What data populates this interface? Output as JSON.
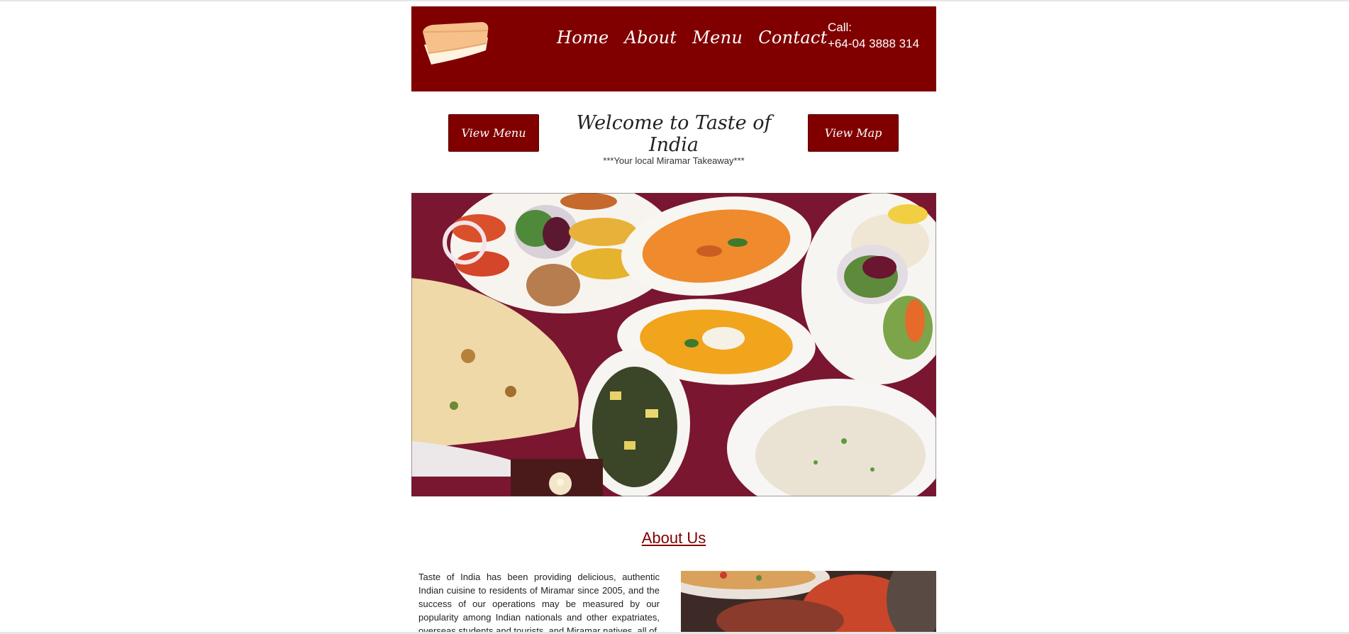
{
  "header": {
    "nav": [
      "Home",
      "About",
      "Menu",
      "Contact"
    ],
    "call_label": "Call:",
    "phone": "+64-04 3888 314",
    "logo_icon": "takeaway-container-icon"
  },
  "intro": {
    "view_menu_label": "View Menu",
    "view_map_label": "View Map",
    "welcome": "Welcome to Taste of India",
    "tagline": "***Your local Miramar Takeaway***"
  },
  "about": {
    "title": "About Us",
    "text": "Taste of India has been providing delicious, authentic Indian cuisine to residents of Miramar since 2005, and the success of our operations may be measured by our popularity among Indian nationals and other expatriates, overseas students and tourists, and Miramar natives, all of"
  },
  "colors": {
    "brand": "#800000",
    "background": "#ffffff",
    "text": "#222222"
  }
}
